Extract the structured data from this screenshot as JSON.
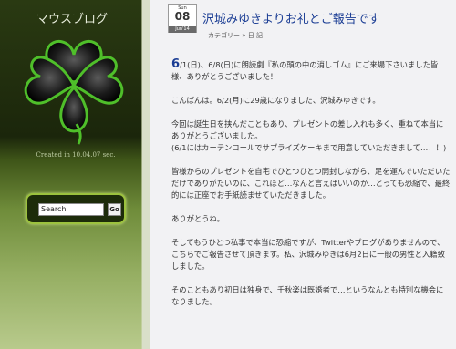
{
  "sidebar": {
    "blog_title": "マウスブログ",
    "created_text": "Created in 10.04.07 sec.",
    "search": {
      "placeholder": "Search",
      "button_label": "Go"
    }
  },
  "post": {
    "date": {
      "dow": "Sun",
      "day": "08",
      "month": "Jun'14"
    },
    "title": "沢城みゆきよりお礼とご報告です",
    "category_label": "カテゴリー",
    "category_sep": "»",
    "category_value": "日 記",
    "dropcap": "6",
    "paragraphs": [
      "/1(日)、6/8(日)に朗読劇『私の頭の中の消しゴム』にご来場下さいました皆様、ありがとうございました！",
      "こんばんは。6/2(月)に29歳になりました、沢城みゆきです。",
      "今回は誕生日を挟んだこともあり、プレゼントの差し入れも多く、重ねて本当にありがとうございました。\n(6/1にはカーテンコールでサプライズケーキまで用意していただきまして…！！)",
      "皆様からのプレゼントを自宅でひとつひとつ開封しながら、足を運んでいただいただけでありがたいのに、これほど…なんと言えばいいのか…とっても恐縮で、最終的には正座でお手紙読ませていただきました。",
      "ありがとうね。",
      "そしてもうひとつ私事で本当に恐縮ですが、Twitterやブログがありませんので、こちらでご報告させて頂きます。私、沢城みゆきは6月2日に一般の男性と入籍致しました。",
      "そのこともあり初日は独身で、千秋楽は既婚者で…というなんとも特別な機会になりました。"
    ]
  }
}
